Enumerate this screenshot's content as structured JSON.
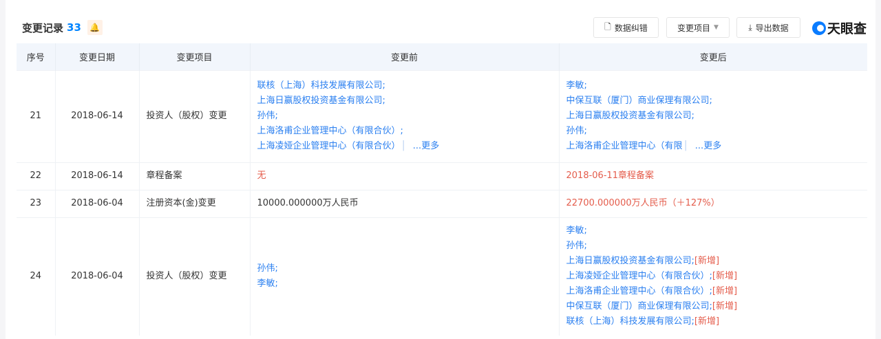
{
  "header": {
    "title": "变更记录",
    "count": "33",
    "buttons": {
      "correct": "数据纠错",
      "filter": "变更项目",
      "export": "导出数据"
    },
    "logo": "天眼查"
  },
  "columns": [
    "序号",
    "变更日期",
    "变更项目",
    "变更前",
    "变更后"
  ],
  "more": "...更多",
  "new_tag": "[新增]",
  "rows": [
    {
      "no": "21",
      "date": "2018-06-14",
      "item": "投资人（股权）变更",
      "before": [
        "联核（上海）科技发展有限公司;",
        "上海日赢股权投资基金有限公司;",
        "孙伟;",
        "上海洛甫企业管理中心（有限合伙）;",
        "上海凌娅企业管理中心（有限合伙）"
      ],
      "after": [
        "李敏;",
        "中保互联（厦门）商业保理有限公司;",
        "上海日赢股权投资基金有限公司;",
        "孙伟;",
        "上海洛甫企业管理中心（有限"
      ]
    },
    {
      "no": "22",
      "date": "2018-06-14",
      "item": "章程备案",
      "before": "无",
      "after": "2018-06-11章程备案"
    },
    {
      "no": "23",
      "date": "2018-06-04",
      "item": "注册资本(金)变更",
      "before": "10000.000000万人民币",
      "after": "22700.000000万人民币（＋127%）"
    },
    {
      "no": "24",
      "date": "2018-06-04",
      "item": "投资人（股权）变更",
      "before": [
        "孙伟;",
        "李敏;"
      ],
      "after": [
        "李敏;",
        "孙伟;",
        "上海日赢股权投资基金有限公司;",
        "上海凌娅企业管理中心（有限合伙）;",
        "上海洛甫企业管理中心（有限合伙）;",
        "中保互联（厦门）商业保理有限公司;",
        "联核（上海）科技发展有限公司;"
      ]
    }
  ],
  "colors": {
    "link": "#2a7ff0",
    "red": "#e45c4b",
    "accent": "#0084ff"
  }
}
